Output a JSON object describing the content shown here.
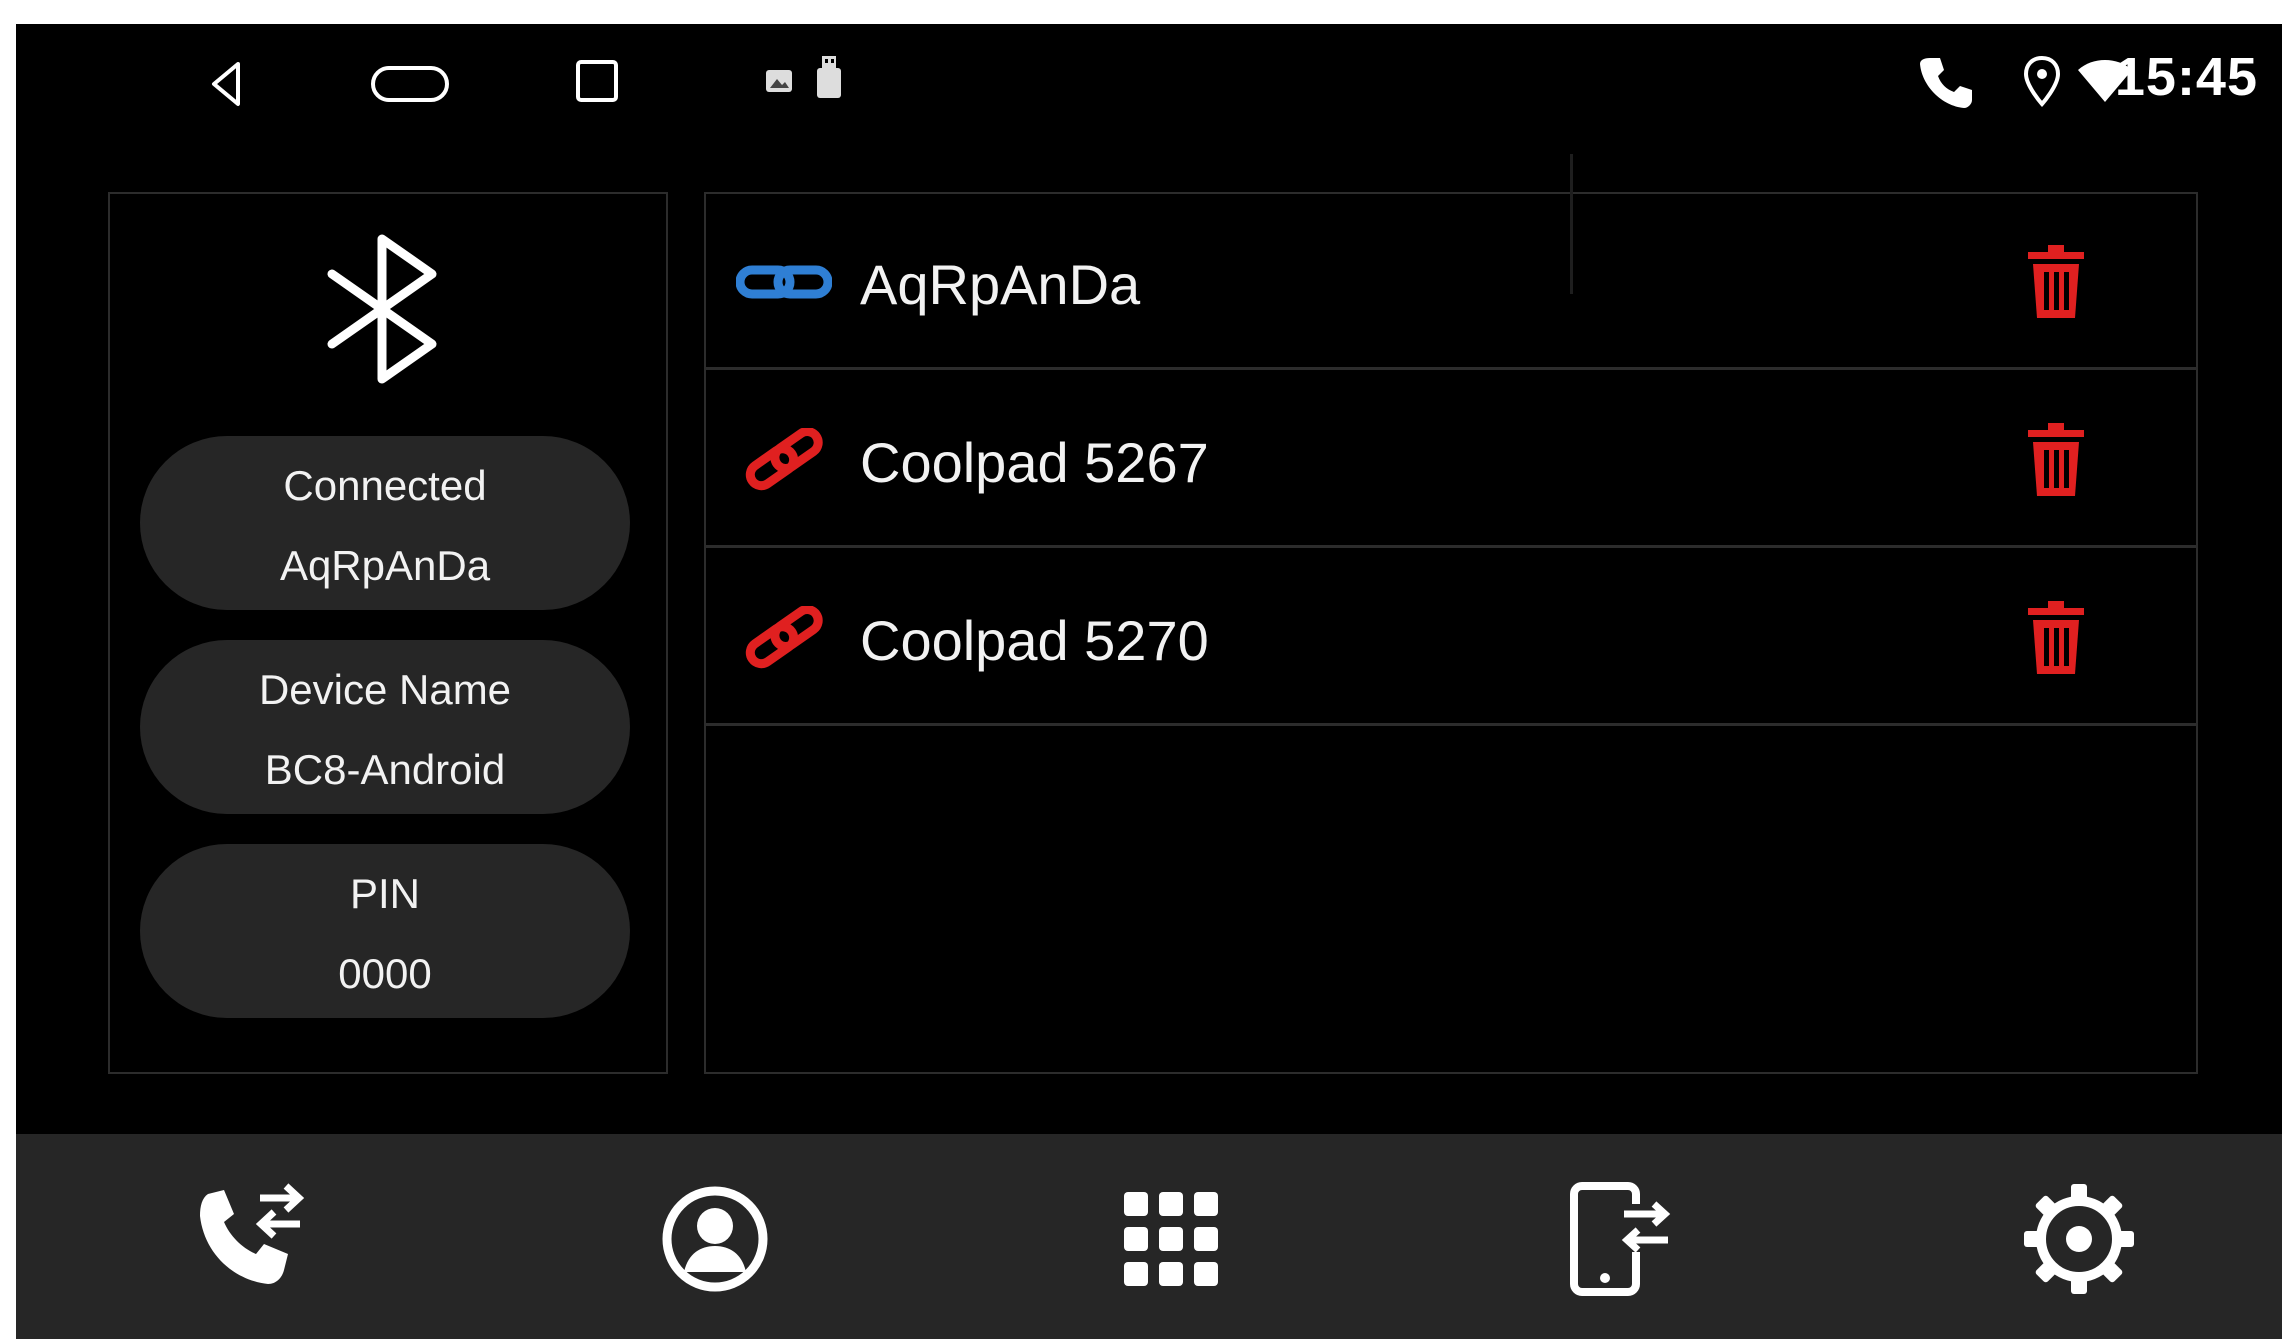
{
  "status_bar": {
    "time": "15:45",
    "nav_icons": [
      "back-icon",
      "home-icon",
      "recents-icon"
    ],
    "notification_icons": [
      "image-icon",
      "usb-icon"
    ],
    "status_icons": [
      "phone-icon",
      "location-icon",
      "wifi-icon"
    ]
  },
  "info_panel": {
    "icon": "bluetooth-icon",
    "connected_label": "Connected",
    "connected_value": "AqRpAnDa",
    "device_name_label": "Device Name",
    "device_name_value": "BC8-Android",
    "pin_label": "PIN",
    "pin_value": "0000"
  },
  "devices": [
    {
      "name": "AqRpAnDa",
      "status": "connected",
      "link_color": "#2f7fd4"
    },
    {
      "name": "Coolpad 5267",
      "status": "disconnected",
      "link_color": "#e02020"
    },
    {
      "name": "Coolpad 5270",
      "status": "disconnected",
      "link_color": "#e02020"
    }
  ],
  "colors": {
    "delete": "#e02020",
    "connected_link": "#2f7fd4",
    "disconnected_link": "#e02020",
    "panel_bg": "#262626"
  },
  "bottom_nav": {
    "items": [
      "call-transfer-icon",
      "contacts-icon",
      "dialpad-icon",
      "phone-transfer-icon",
      "settings-icon"
    ]
  }
}
